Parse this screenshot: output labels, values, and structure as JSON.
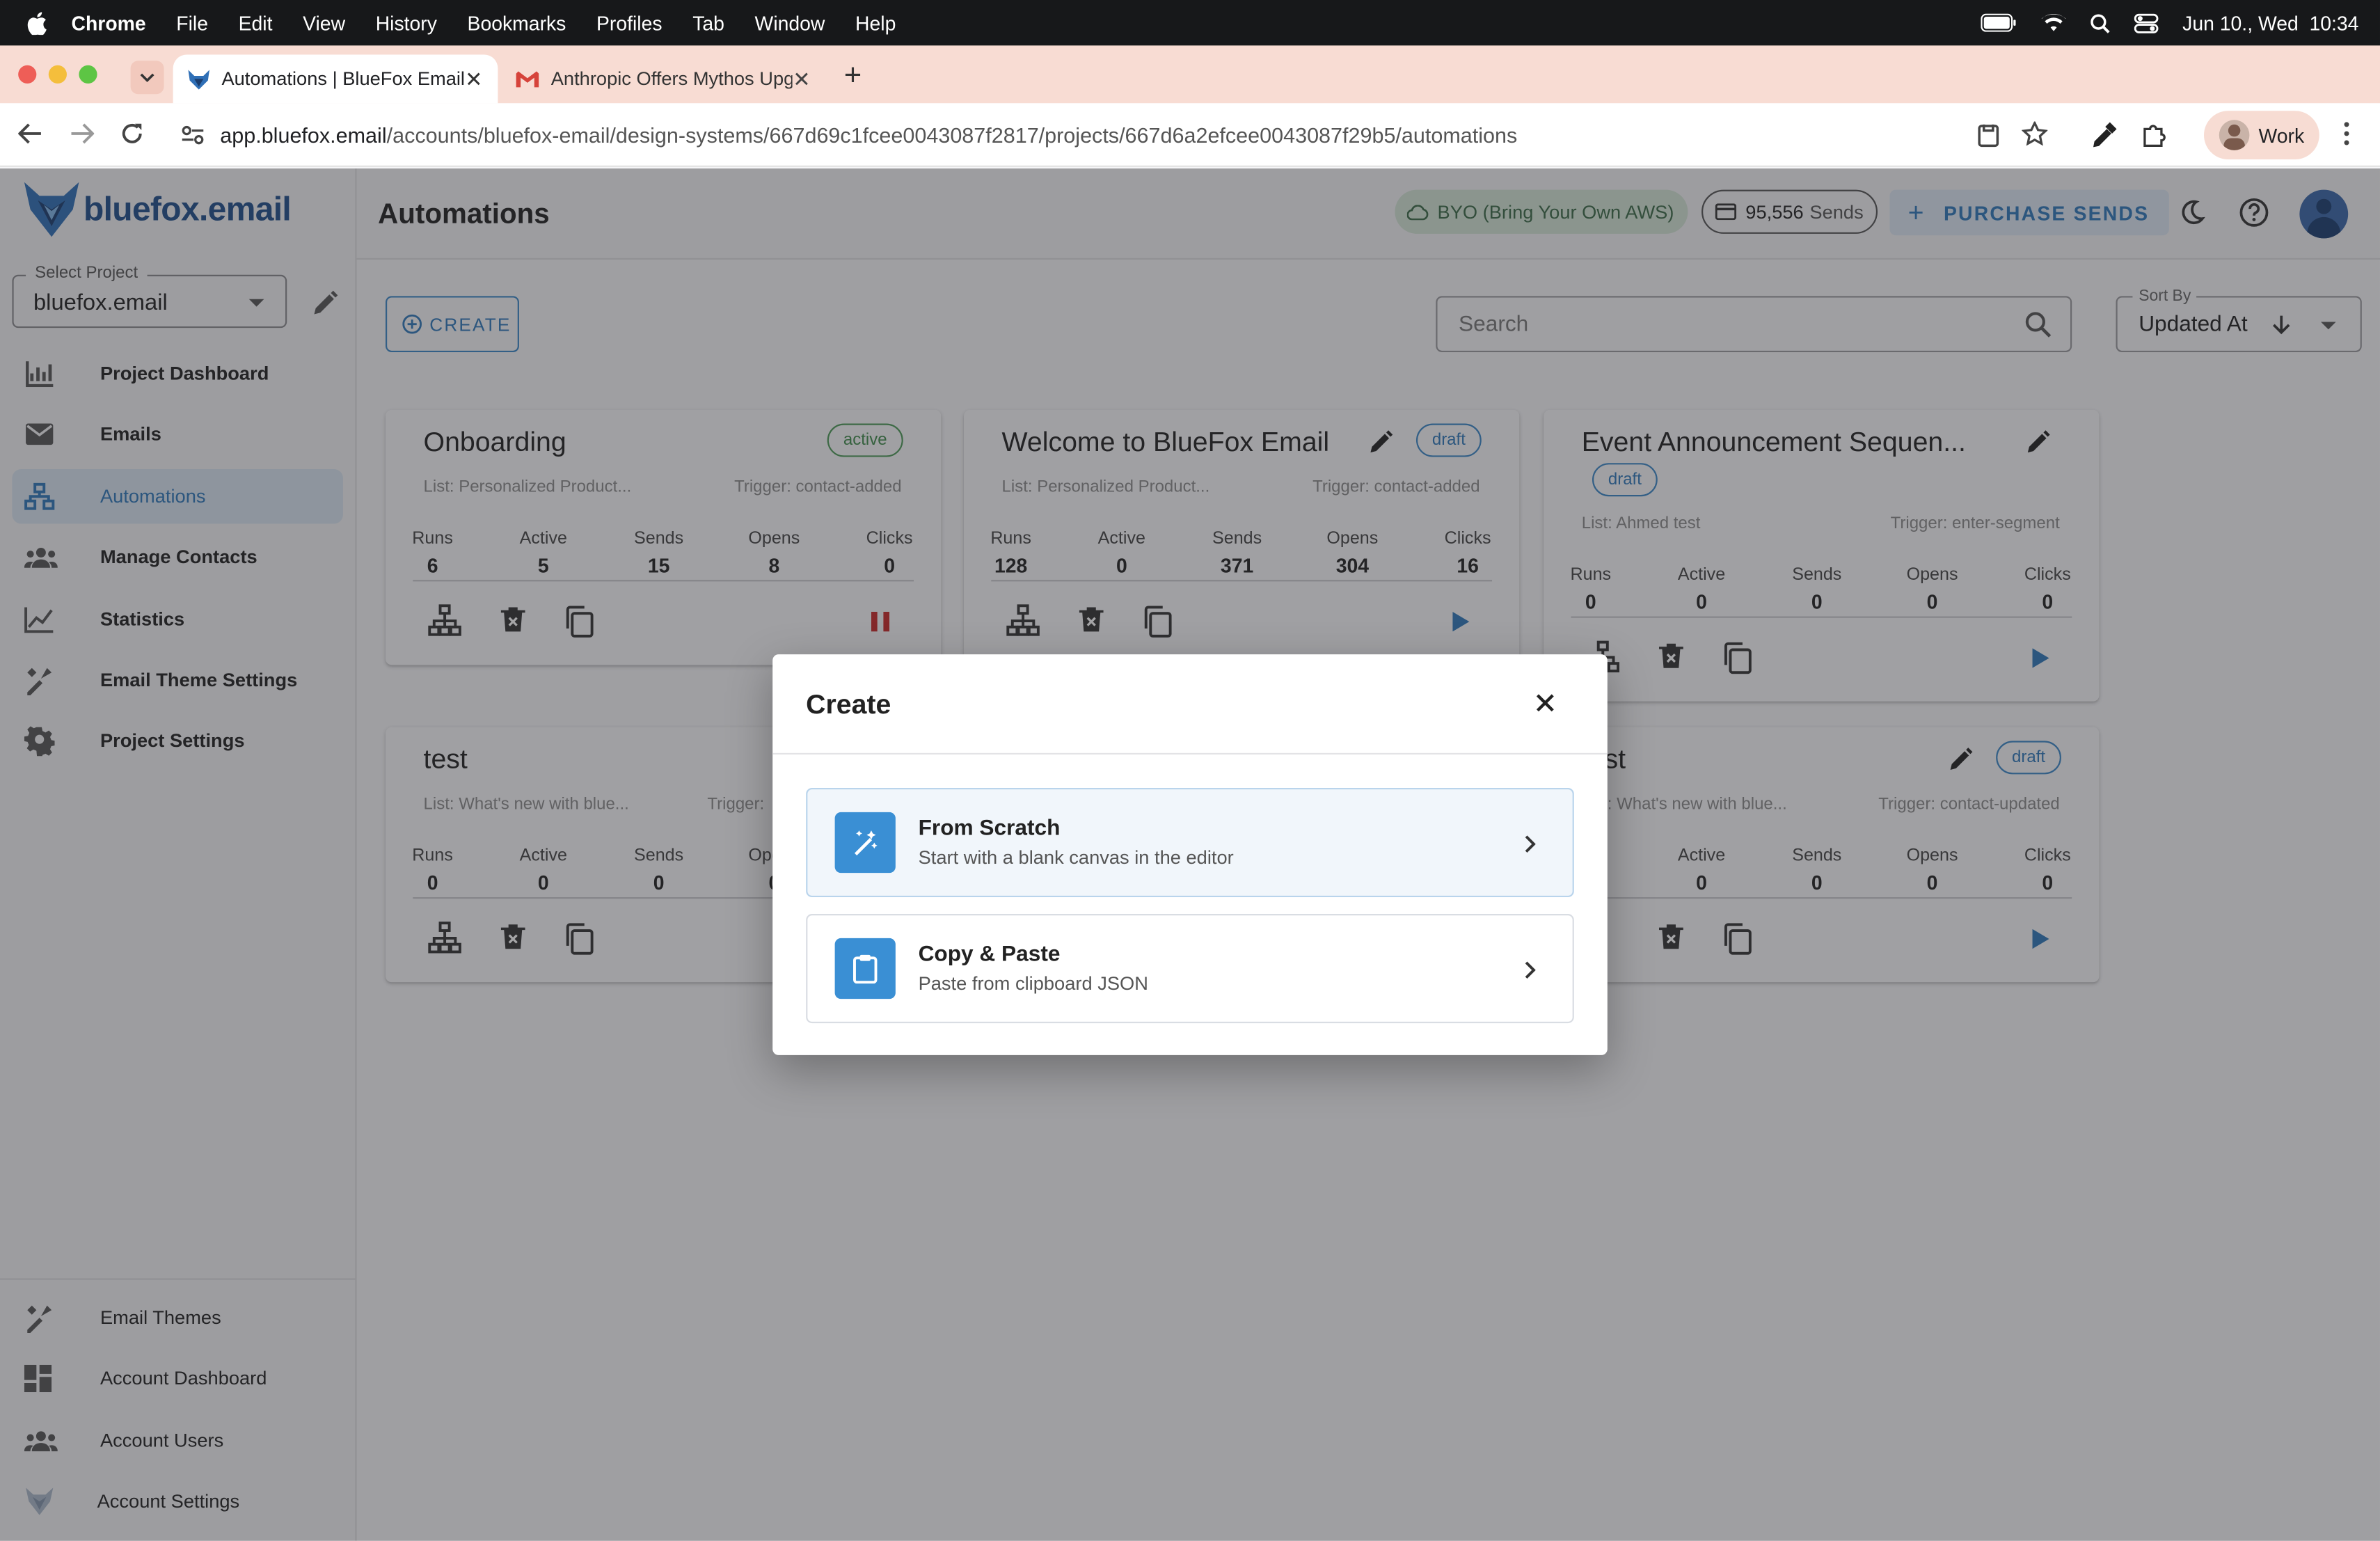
{
  "mac_menu": {
    "app": "Chrome",
    "items": [
      "File",
      "Edit",
      "View",
      "History",
      "Bookmarks",
      "Profiles",
      "Tab",
      "Window",
      "Help"
    ],
    "datetime": "Jun 10., Wed  10:34"
  },
  "browser": {
    "tabs": [
      {
        "title": "Automations | BlueFox Email"
      },
      {
        "title": "Anthropic Offers Mythos Upg"
      }
    ],
    "url_host": "app.bluefox.email",
    "url_path": "/accounts/bluefox-email/design-systems/667d69c1fcee0043087f2817/projects/667d6a2efcee0043087f29b5/automations",
    "profile": "Work"
  },
  "sidebar": {
    "logo": "bluefox.email",
    "project_label": "Select Project",
    "project_value": "bluefox.email",
    "items": [
      {
        "label": "Project Dashboard",
        "icon": "chart-icon"
      },
      {
        "label": "Emails",
        "icon": "mail-icon"
      },
      {
        "label": "Automations",
        "icon": "sitemap-icon"
      },
      {
        "label": "Manage Contacts",
        "icon": "contacts-icon"
      },
      {
        "label": "Statistics",
        "icon": "line-chart-icon"
      },
      {
        "label": "Email Theme Settings",
        "icon": "brush-icon"
      },
      {
        "label": "Project Settings",
        "icon": "gear-icon"
      }
    ],
    "bottom_items": [
      {
        "label": "Email Themes",
        "icon": "brush-icon"
      },
      {
        "label": "Account Dashboard",
        "icon": "dashboard-icon"
      },
      {
        "label": "Account Users",
        "icon": "users-icon"
      },
      {
        "label": "Account Settings",
        "icon": "fox-icon"
      }
    ]
  },
  "header": {
    "title": "Automations",
    "byo": "BYO (Bring Your Own AWS)",
    "sends_count": "95,556",
    "sends_label": "Sends",
    "purchase": "PURCHASE SENDS"
  },
  "toolbar": {
    "create": "CREATE",
    "search_placeholder": "Search",
    "sort_label": "Sort By",
    "sort_value": "Updated At"
  },
  "stat_labels": [
    "Runs",
    "Active",
    "Sends",
    "Opens",
    "Clicks"
  ],
  "cards": [
    {
      "title": "Onboarding",
      "status": "active",
      "list": "List: Personalized Product...",
      "trigger": "Trigger: contact-added",
      "stats": [
        "6",
        "5",
        "15",
        "8",
        "0"
      ]
    },
    {
      "title": "Welcome to BlueFox Email",
      "status": "draft",
      "list": "List: Personalized Product...",
      "trigger": "Trigger: contact-added",
      "stats": [
        "128",
        "0",
        "371",
        "304",
        "16"
      ]
    },
    {
      "title": "Event Announcement Sequen...",
      "status": "draft",
      "list": "List: Ahmed test",
      "trigger": "Trigger: enter-segment",
      "stats": [
        "0",
        "0",
        "0",
        "0",
        "0"
      ]
    },
    {
      "title": "test",
      "status": "",
      "list": "List: What's new with blue...",
      "trigger": "Trigger:",
      "stats": [
        "0",
        "0",
        "0",
        "0"
      ]
    },
    {
      "title": "st",
      "status": "draft",
      "list": ": What's new with blue...",
      "trigger": "Trigger: contact-updated",
      "stats": [
        "0",
        "0",
        "0",
        "0"
      ]
    }
  ],
  "dialog": {
    "title": "Create",
    "options": [
      {
        "title": "From Scratch",
        "subtitle": "Start with a blank canvas in the editor",
        "icon": "magic-wand-icon"
      },
      {
        "title": "Copy & Paste",
        "subtitle": "Paste from clipboard JSON",
        "icon": "clipboard-icon"
      }
    ]
  }
}
